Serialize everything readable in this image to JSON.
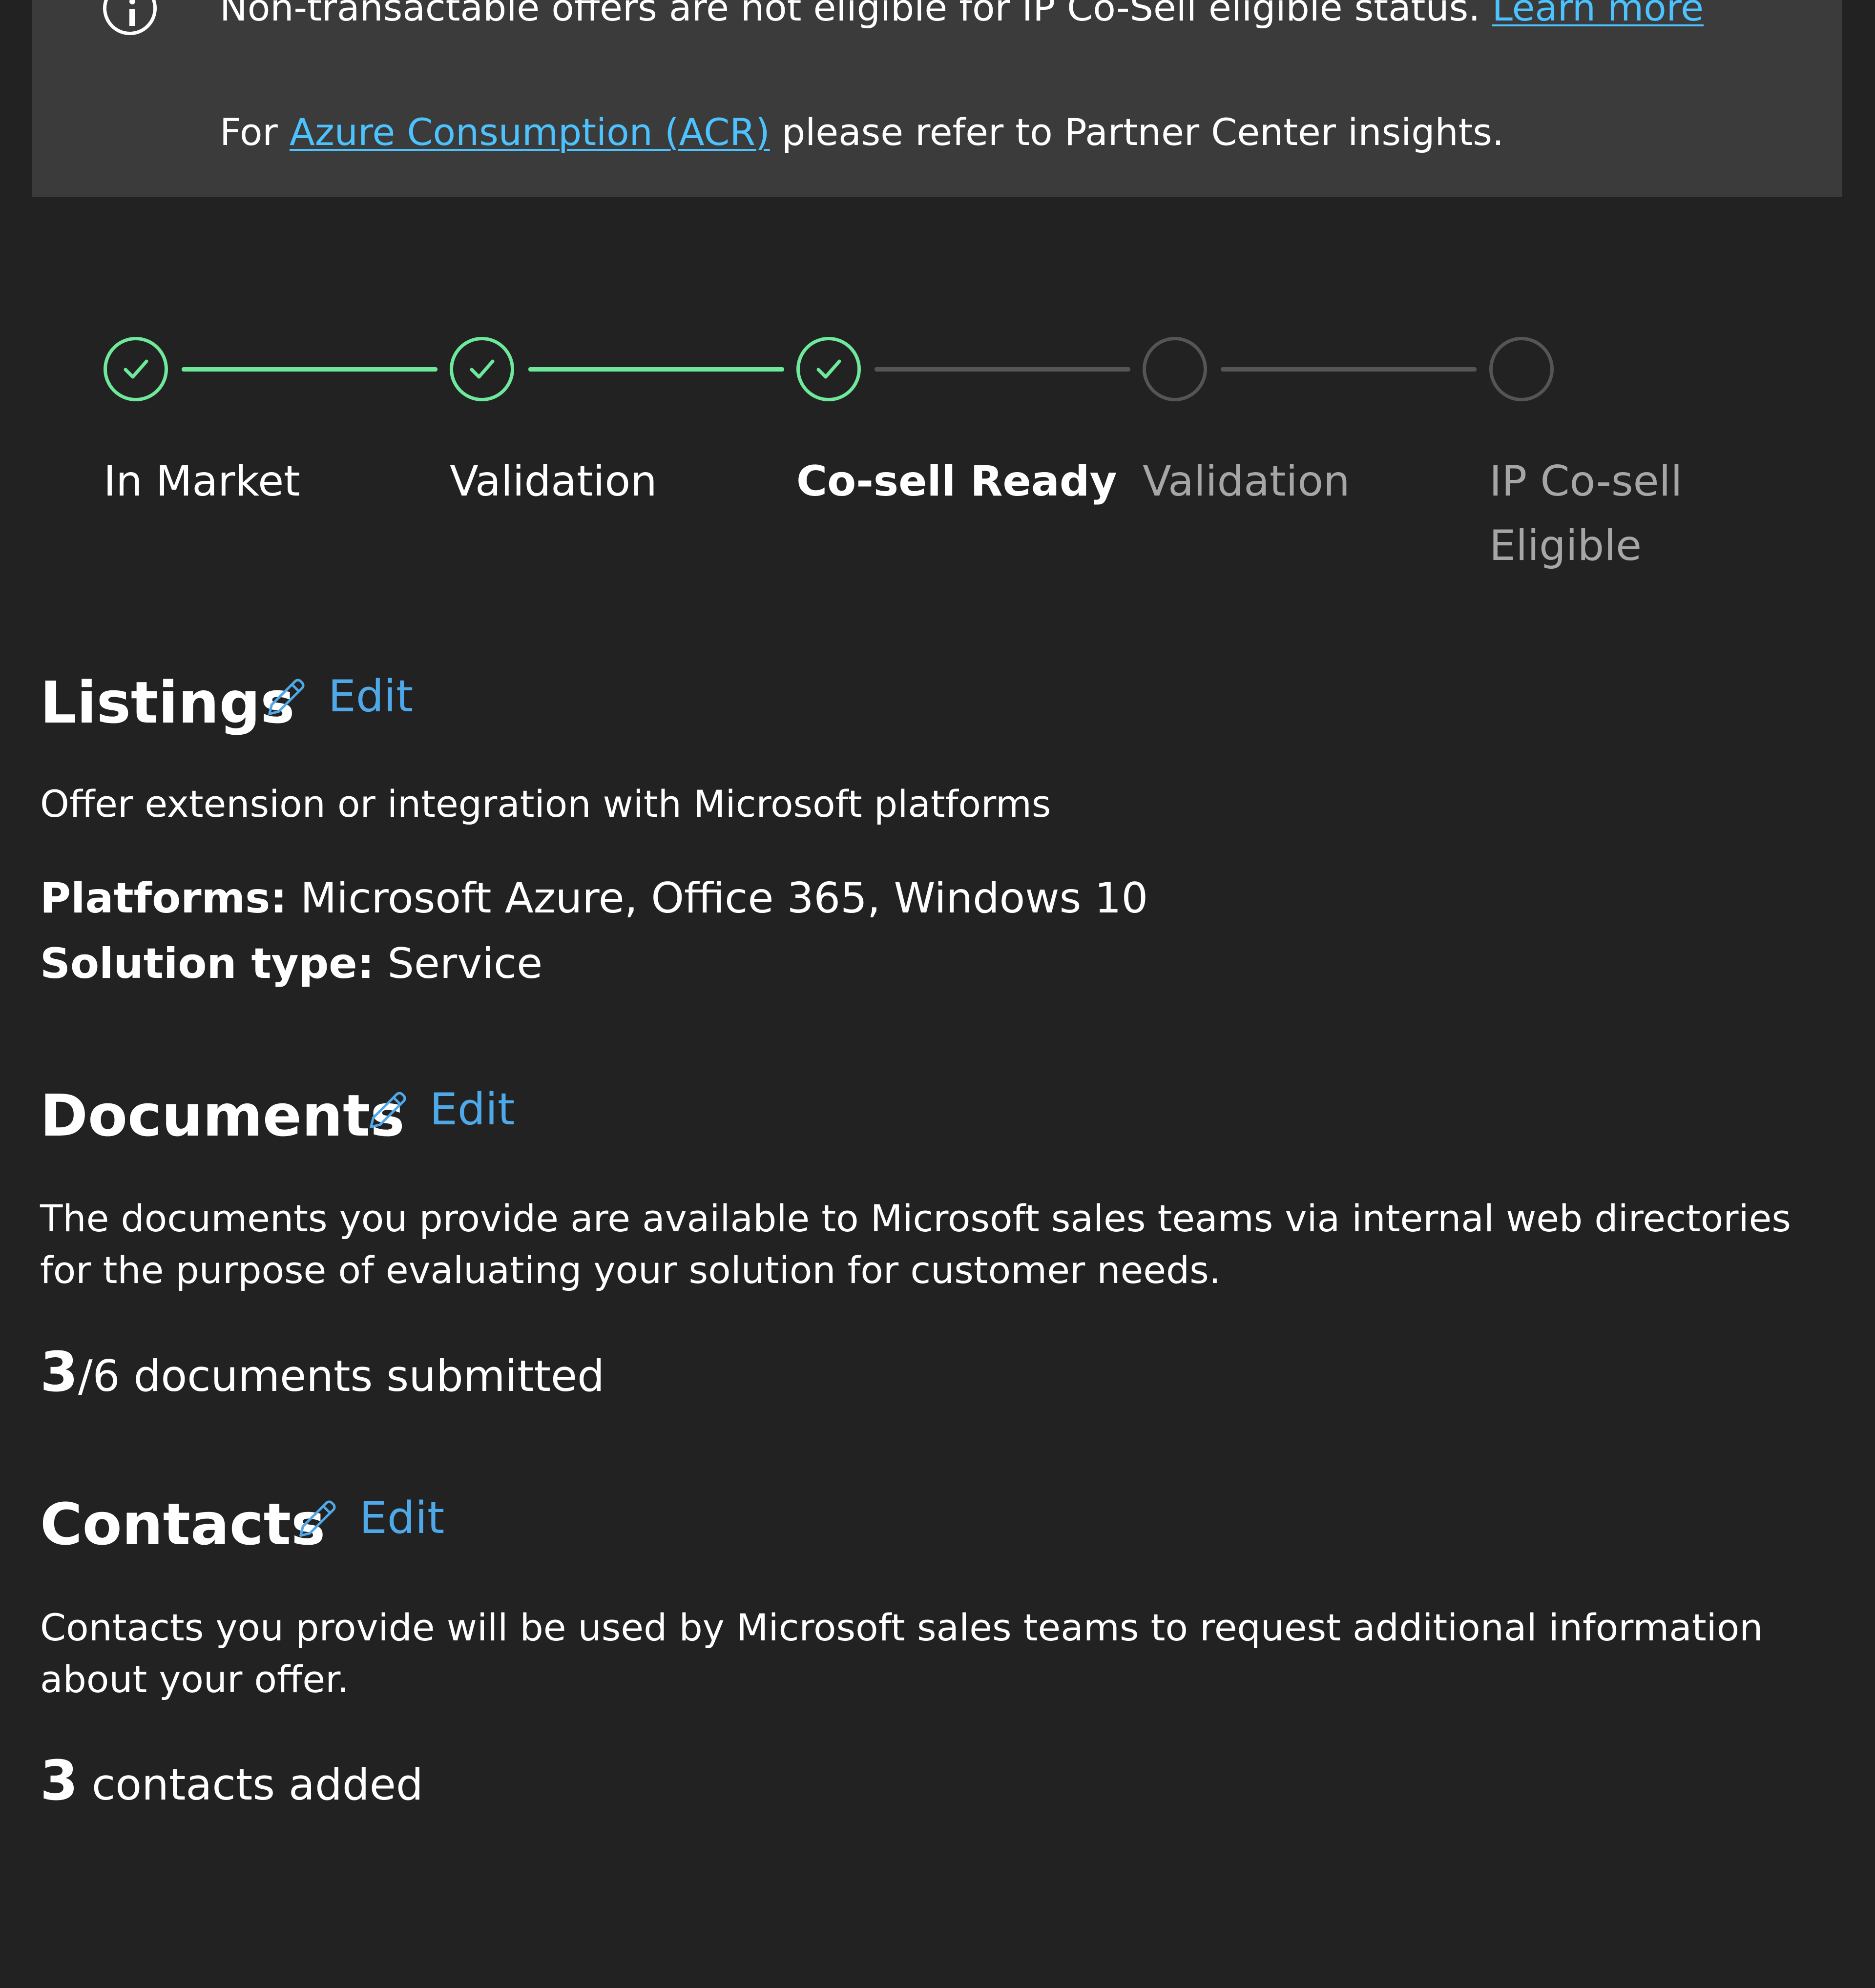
{
  "banner": {
    "line1_text": "Non-transactable offers are not eligible for IP Co-Sell eligible status.",
    "line1_link": "Learn more",
    "line2_prefix": "For",
    "line2_link": "Azure Consumption (ACR)",
    "line2_suffix": "please refer to Partner Center insights.",
    "icon": "info-icon"
  },
  "stepper": {
    "steps": [
      {
        "label": "In Market",
        "state": "complete"
      },
      {
        "label": "Validation",
        "state": "complete"
      },
      {
        "label": "Co-sell Ready",
        "state": "current"
      },
      {
        "label": "Validation",
        "state": "incomplete"
      },
      {
        "label": "IP Co-sell Eligible",
        "state": "incomplete"
      }
    ],
    "complete_color": "#6ee89a",
    "incomplete_color": "#555555"
  },
  "listings": {
    "title": "Listings",
    "edit_label": "Edit",
    "description": "Offer extension or integration with Microsoft platforms",
    "platforms_label": "Platforms:",
    "platforms_value": "Microsoft Azure, Office 365, Windows 10",
    "solution_type_label": "Solution type:",
    "solution_type_value": "Service"
  },
  "documents": {
    "title": "Documents",
    "edit_label": "Edit",
    "description": "The documents you provide are available to Microsoft sales teams via internal web directories for the purpose of evaluating your solution for customer needs.",
    "submitted_count": "3",
    "submitted_rest": "/6 documents submitted"
  },
  "contacts": {
    "title": "Contacts",
    "edit_label": "Edit",
    "description": "Contacts you provide will be used by Microsoft sales teams to request additional information about your offer.",
    "added_count": "3",
    "added_rest": " contacts added"
  },
  "colors": {
    "background": "#222222",
    "banner_background": "#3b3b3b",
    "link": "#4cc2ff",
    "edit": "#4fa8e8"
  }
}
